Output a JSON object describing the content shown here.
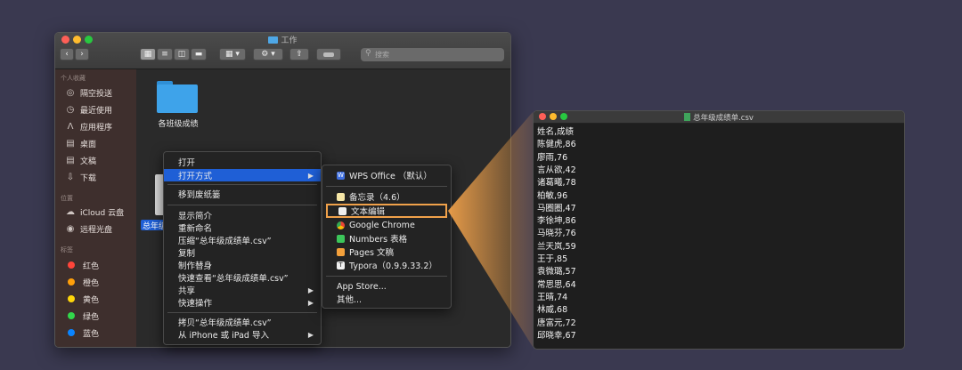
{
  "finder": {
    "title": "工作",
    "search_placeholder": "搜索",
    "sidebar": {
      "favorites_header": "个人收藏",
      "favorites": [
        {
          "label": "隔空投送",
          "icon": "airdrop-icon"
        },
        {
          "label": "最近使用",
          "icon": "clock-icon"
        },
        {
          "label": "应用程序",
          "icon": "applications-icon"
        },
        {
          "label": "桌面",
          "icon": "desktop-icon"
        },
        {
          "label": "文稿",
          "icon": "document-icon"
        },
        {
          "label": "下载",
          "icon": "download-icon"
        }
      ],
      "locations_header": "位置",
      "locations": [
        {
          "label": "iCloud 云盘",
          "icon": "cloud-icon"
        },
        {
          "label": "远程光盘",
          "icon": "disc-icon"
        }
      ],
      "tags_header": "标签",
      "tags": [
        {
          "label": "红色",
          "color": "#ff453a"
        },
        {
          "label": "橙色",
          "color": "#ff9f0a"
        },
        {
          "label": "黄色",
          "color": "#ffd60a"
        },
        {
          "label": "绿色",
          "color": "#32d74b"
        },
        {
          "label": "蓝色",
          "color": "#0a84ff"
        }
      ]
    },
    "files": [
      {
        "name": "各班级成绩",
        "type": "folder"
      },
      {
        "name": "总年级成绩单.csv",
        "type": "csv",
        "visible_label": "总年级"
      }
    ]
  },
  "context_menu": {
    "open": "打开",
    "open_with": "打开方式",
    "trash": "移到废纸篓",
    "get_info": "显示简介",
    "rename": "重新命名",
    "compress": "压缩“总年级成绩单.csv”",
    "duplicate": "复制",
    "make_alias": "制作替身",
    "quick_look": "快速查看“总年级成绩单.csv”",
    "share": "共享",
    "quick_actions": "快速操作",
    "copy_item": "拷贝“总年级成绩单.csv”",
    "import_from": "从 iPhone 或 iPad 导入"
  },
  "open_with_menu": {
    "default_app": "WPS Office （默认）",
    "apps": [
      "备忘录（4.6）",
      "文本编辑",
      "Google Chrome",
      "Numbers 表格",
      "Pages 文稿",
      "Typora（0.9.9.33.2）"
    ],
    "app_store": "App Store...",
    "other": "其他..."
  },
  "textedit": {
    "title": "总年级成绩单.csv",
    "lines": [
      "姓名,成绩",
      "陈健虎,86",
      "廖雨,76",
      "言从欲,42",
      "诸葛曦,78",
      "柏敏,96",
      "马圈圈,47",
      "李徐坤,86",
      "马晓芬,76",
      "兰天岚,59",
      "王于,85",
      "袁微璐,57",
      "常思思,64",
      "王晴,74",
      "林威,68",
      "唐富元,72",
      "邱晓幸,67"
    ]
  },
  "colors": {
    "accent": "#1f5fd6",
    "highlight": "#f0a14a"
  }
}
